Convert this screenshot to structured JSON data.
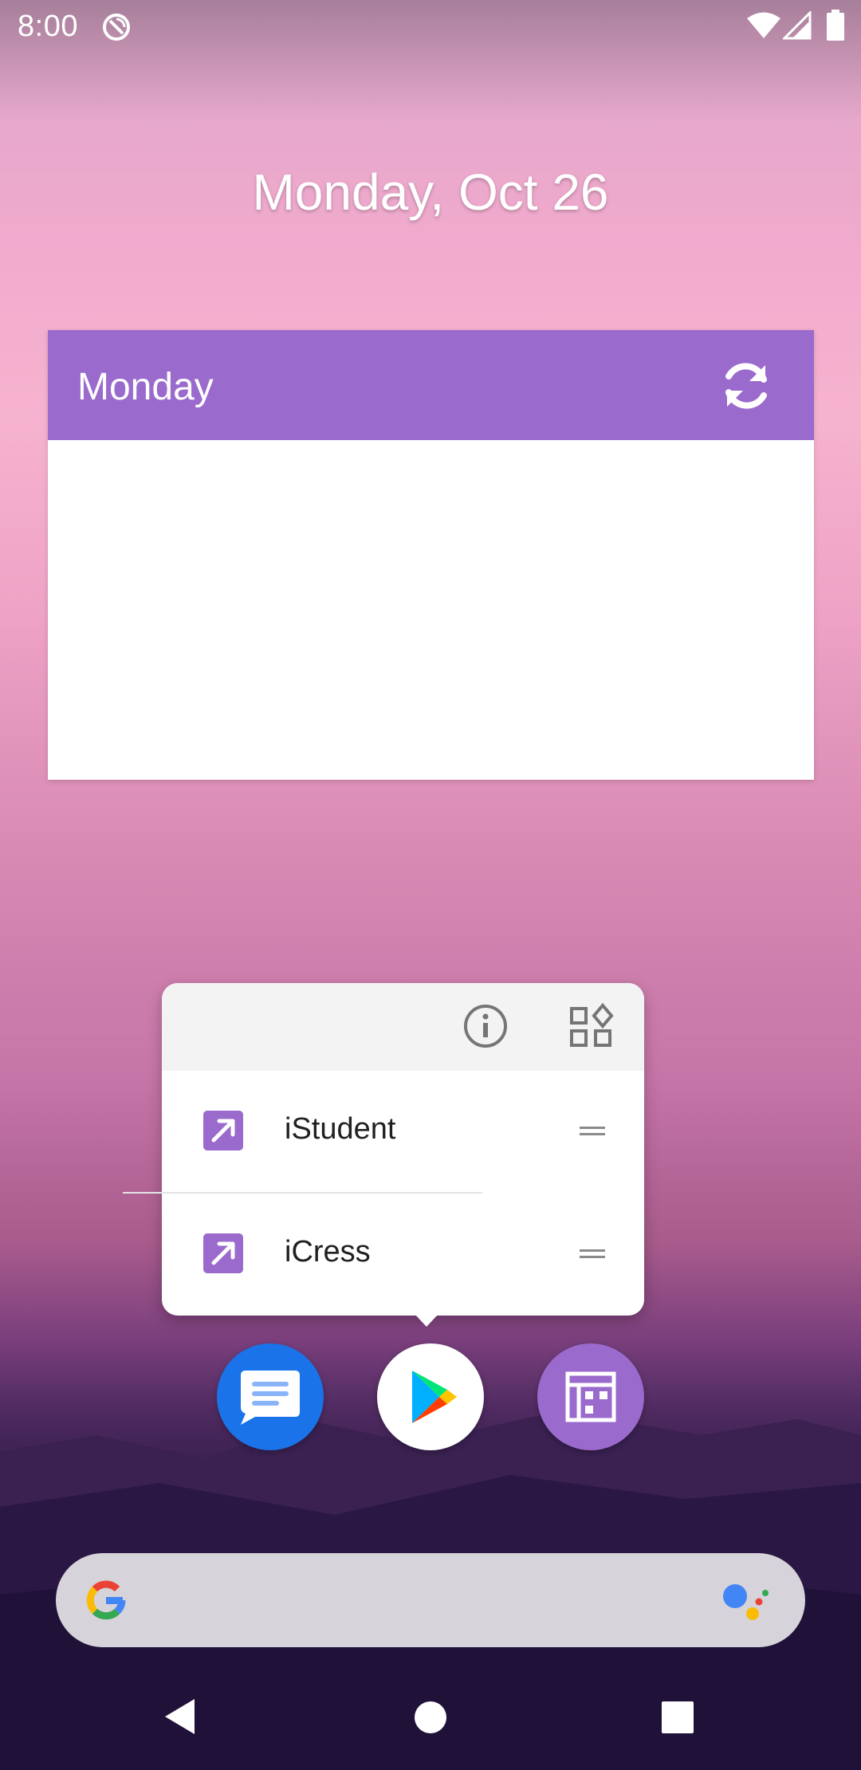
{
  "status_bar": {
    "time": "8:00",
    "icons": [
      "sync-disabled-icon",
      "wifi-icon",
      "cellular-signal-icon",
      "battery-icon"
    ]
  },
  "date": "Monday, Oct 26",
  "widget": {
    "title": "Monday",
    "refresh_icon": "refresh-icon",
    "header_color": "#9a6acd"
  },
  "popup": {
    "actions": [
      "app-info-icon",
      "widgets-icon"
    ],
    "shortcuts": [
      {
        "label": "iStudent",
        "icon": "shortcut-arrow-icon"
      },
      {
        "label": "iCress",
        "icon": "shortcut-arrow-icon"
      }
    ]
  },
  "dock": {
    "apps": [
      {
        "name": "messages",
        "icon": "messages-icon",
        "color": "#1a73e8"
      },
      {
        "name": "play-store",
        "icon": "play-store-icon",
        "color": "#ffffff"
      },
      {
        "name": "timetable",
        "icon": "timetable-icon",
        "color": "#9a6acd"
      }
    ]
  },
  "search_bar": {
    "left_icon": "google-g-icon",
    "right_icon": "google-assistant-icon"
  },
  "nav_bar": {
    "buttons": [
      "back-icon",
      "home-icon",
      "recents-icon"
    ]
  },
  "colors": {
    "accent": "#9a6acd",
    "popup_bg": "#ffffff",
    "popup_header_bg": "#f3f3f3"
  }
}
